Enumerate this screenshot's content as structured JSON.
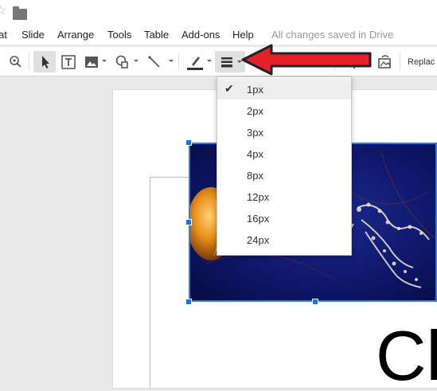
{
  "menu": {
    "items": [
      "at",
      "Slide",
      "Arrange",
      "Tools",
      "Table",
      "Add-ons",
      "Help"
    ],
    "saved_status": "All changes saved in Drive"
  },
  "toolbar": {
    "replace_label": "Replac",
    "icons": [
      "zoom-icon",
      "select-icon",
      "textbox-icon",
      "image-icon",
      "shape-icon",
      "line-icon",
      "line-color-icon",
      "line-weight-icon",
      "crop-icon",
      "mask-icon",
      "replace-image-icon"
    ]
  },
  "line_weight_menu": {
    "options": [
      "1px",
      "2px",
      "3px",
      "4px",
      "8px",
      "12px",
      "16px",
      "24px"
    ],
    "selected": "1px"
  },
  "slide": {
    "text": "Cl"
  },
  "colors": {
    "accent": "#1a73e8",
    "arrow": "#e4202a",
    "selection_border": "#3b7bd4"
  }
}
